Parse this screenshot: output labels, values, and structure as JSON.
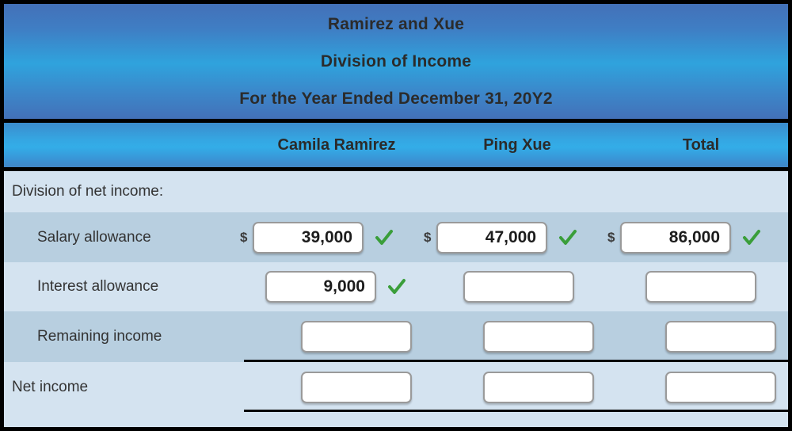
{
  "statement": {
    "title_lines": [
      "Ramirez and Xue",
      "Division of Income",
      "For the Year Ended December 31, 20Y2"
    ],
    "columns": [
      {
        "label": "Camila Ramirez"
      },
      {
        "label": "Ping Xue"
      },
      {
        "label": "Total"
      }
    ],
    "currency_symbol": "$",
    "rows": [
      {
        "label": "Division of net income:",
        "indent": false,
        "cells": []
      },
      {
        "label": "Salary allowance",
        "indent": true,
        "cells": [
          {
            "dollar": "$",
            "value": "39,000",
            "check": true
          },
          {
            "dollar": "$",
            "value": "47,000",
            "check": true
          },
          {
            "dollar": "$",
            "value": "86,000",
            "check": true
          }
        ]
      },
      {
        "label": "Interest allowance",
        "indent": true,
        "cells": [
          {
            "dollar": "",
            "value": "9,000",
            "check": true
          },
          {
            "dollar": "",
            "value": "",
            "check": false
          },
          {
            "dollar": "",
            "value": "",
            "check": false
          }
        ]
      },
      {
        "label": "Remaining income",
        "indent": true,
        "cells": [
          {
            "dollar": "",
            "value": "",
            "check": false
          },
          {
            "dollar": "",
            "value": "",
            "check": false
          },
          {
            "dollar": "",
            "value": "",
            "check": false
          }
        ]
      },
      {
        "label": "Net income",
        "indent": false,
        "cells": [
          {
            "dollar": "",
            "value": "",
            "check": false
          },
          {
            "dollar": "",
            "value": "",
            "check": false
          },
          {
            "dollar": "",
            "value": "",
            "check": false
          }
        ]
      }
    ]
  },
  "colors": {
    "header_gradient_top": "#4371b8",
    "header_gradient_mid": "#2fa3dd",
    "column_band_mid": "#33ade8",
    "row_light": "#d4e3f0",
    "row_dark": "#b8cfe0",
    "check_green": "#3a9e3a",
    "text_dark": "#333333",
    "frame_black": "#000000"
  }
}
